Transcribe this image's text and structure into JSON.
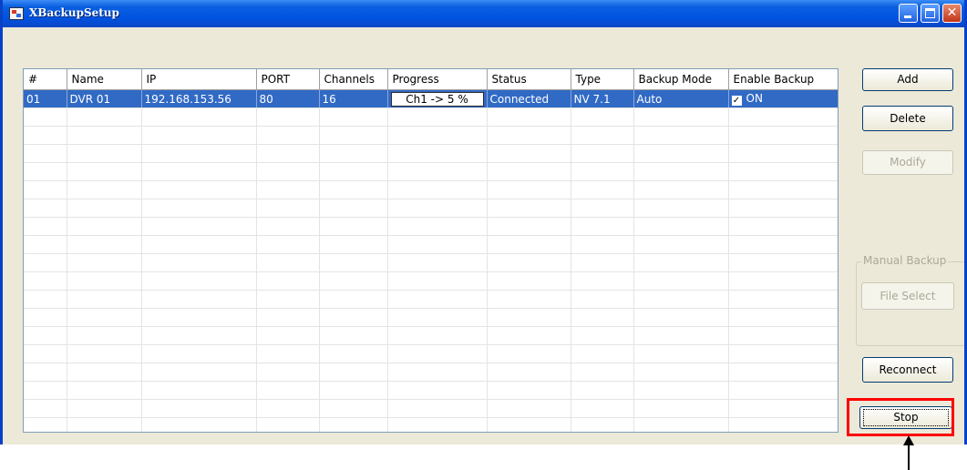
{
  "window": {
    "title": "XBackupSetup"
  },
  "table": {
    "columns": [
      "#",
      "Name",
      "IP",
      "PORT",
      "Channels",
      "Progress",
      "Status",
      "Type",
      "Backup Mode",
      "Enable Backup"
    ],
    "rows": [
      {
        "num": "01",
        "name": "DVR 01",
        "ip": "192.168.153.56",
        "port": "80",
        "channels": "16",
        "progress": "Ch1 -> 5 %",
        "status": "Connected",
        "type": "NV 7.1",
        "backup_mode": "Auto",
        "enable_checked": true,
        "enable_label": "ON",
        "selected": true
      }
    ],
    "empty_rows": 19
  },
  "buttons": {
    "add": "Add",
    "delete": "Delete",
    "modify": "Modify",
    "file_select": "File Select",
    "reconnect": "Reconnect",
    "stop": "Stop"
  },
  "manual_backup": {
    "label": "Manual Backup"
  },
  "colors": {
    "title_bar": "#0a5fe0",
    "selection": "#316ac5",
    "highlight": "#ff0000"
  }
}
